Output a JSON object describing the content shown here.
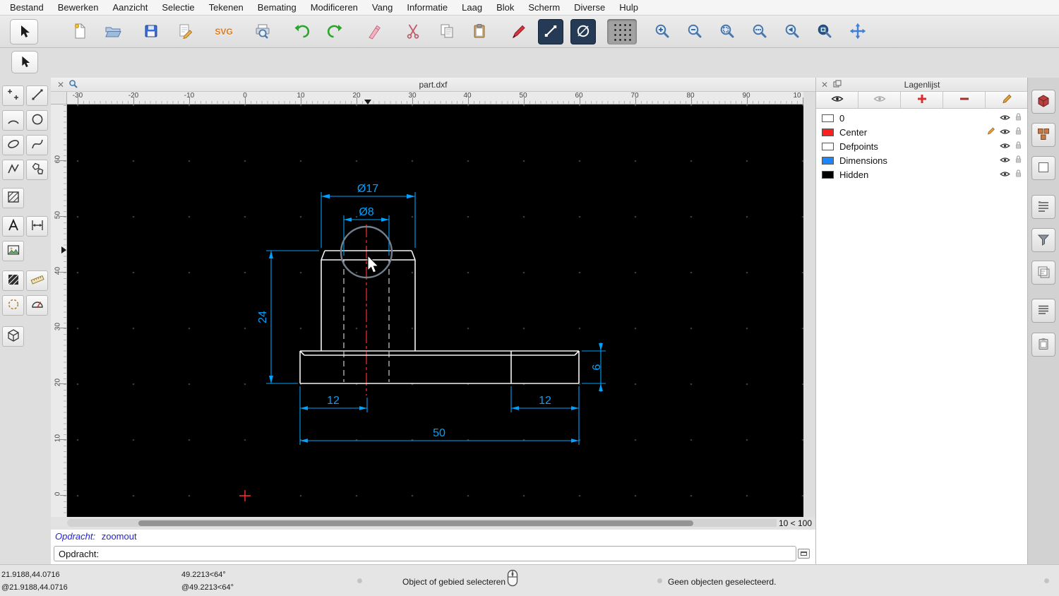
{
  "menubar": {
    "items": [
      "Bestand",
      "Bewerken",
      "Aanzicht",
      "Selectie",
      "Tekenen",
      "Bemating",
      "Modificeren",
      "Vang",
      "Informatie",
      "Laag",
      "Blok",
      "Scherm",
      "Diverse",
      "Hulp"
    ]
  },
  "toolbar": {
    "svg_badge": "SVG"
  },
  "document_tab": {
    "title": "part.dxf"
  },
  "rulers": {
    "h": [
      "-30",
      "-20",
      "-10",
      "0",
      "10",
      "20",
      "30",
      "40",
      "50",
      "60",
      "70",
      "80",
      "90",
      "10"
    ],
    "v": [
      "60",
      "50",
      "40",
      "30",
      "20",
      "10",
      "0"
    ]
  },
  "drawing": {
    "dimensions": {
      "outer_diameter": "Ø17",
      "hole_diameter": "Ø8",
      "height": "24",
      "base_height": "6",
      "left_offset": "12",
      "right_offset": "12",
      "total_width": "50"
    },
    "colors": {
      "outline": "#f4f4f4",
      "hidden_lines": "#e0e0e0",
      "center_line": "#ff2f2f",
      "dimension": "#00a2ff",
      "background": "#000000"
    }
  },
  "grid_status": "10 < 100",
  "layers_panel": {
    "title": "Lagenlijst",
    "layers": [
      {
        "name": "0",
        "color": "#ffffff"
      },
      {
        "name": "Center",
        "color": "#ff1f1f"
      },
      {
        "name": "Defpoints",
        "color": "#ffffff"
      },
      {
        "name": "Dimensions",
        "color": "#1c86ff"
      },
      {
        "name": "Hidden",
        "color": "#000000"
      }
    ]
  },
  "command": {
    "history_prompt": "Opdracht:",
    "history_command": "zoomout",
    "prompt_label": "Opdracht:"
  },
  "statusbar": {
    "abs_coords": "21.9188,44.0716",
    "rel_coords": "@21.9188,44.0716",
    "abs_polar": "49.2213<64°",
    "rel_polar": "@49.2213<64°",
    "hint": "Object of gebied selecteren",
    "selection_status": "Geen objecten geselecteerd."
  }
}
